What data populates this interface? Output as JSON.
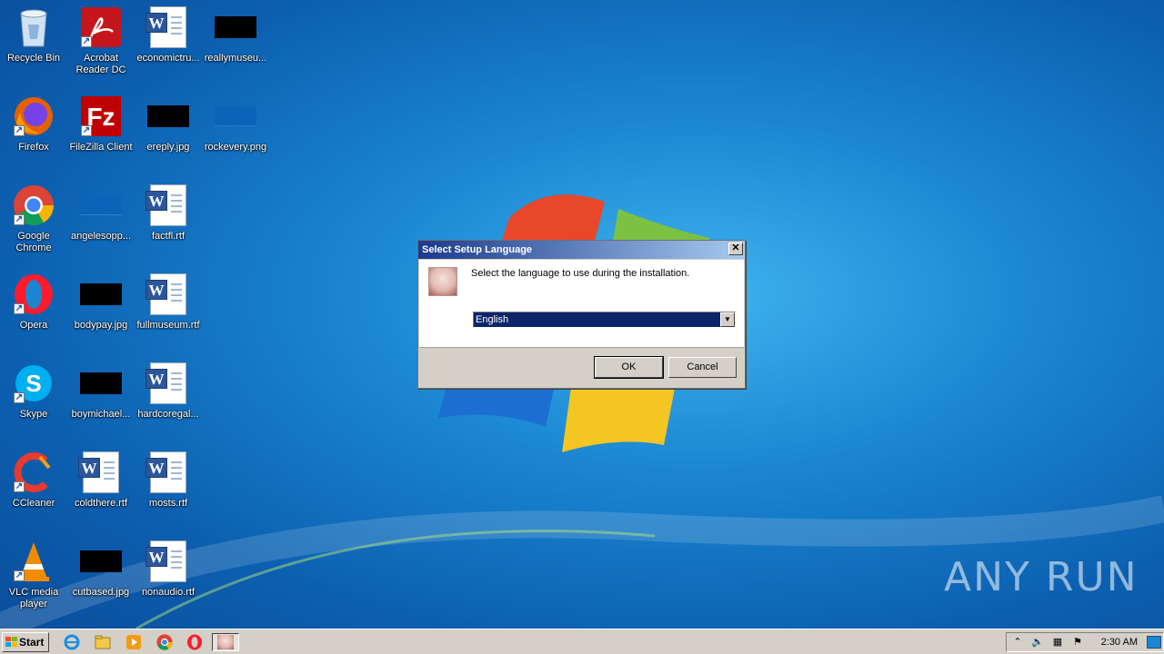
{
  "desktop": {
    "icons": [
      {
        "label": "Recycle Bin",
        "icon": "recycle-bin-icon"
      },
      {
        "label": "Acrobat Reader DC",
        "icon": "acrobat-icon"
      },
      {
        "label": "economictru...",
        "icon": "word-rtf-icon"
      },
      {
        "label": "reallymuseu...",
        "icon": "image-thumbnail-icon"
      },
      {
        "label": "Firefox",
        "icon": "firefox-icon"
      },
      {
        "label": "FileZilla Client",
        "icon": "filezilla-icon"
      },
      {
        "label": "ereply.jpg",
        "icon": "image-thumbnail-icon"
      },
      {
        "label": "rockevery.png",
        "icon": "image-thumbnail-icon"
      },
      {
        "label": "Google Chrome",
        "icon": "chrome-icon"
      },
      {
        "label": "angelesopp...",
        "icon": "image-thumbnail-icon"
      },
      {
        "label": "factfl.rtf",
        "icon": "word-rtf-icon"
      },
      {
        "label": "Opera",
        "icon": "opera-icon"
      },
      {
        "label": "bodypay.jpg",
        "icon": "image-thumbnail-icon"
      },
      {
        "label": "fullmuseum.rtf",
        "icon": "word-rtf-icon"
      },
      {
        "label": "Skype",
        "icon": "skype-icon"
      },
      {
        "label": "boymichael...",
        "icon": "image-thumbnail-icon"
      },
      {
        "label": "hardcoregal...",
        "icon": "word-rtf-icon"
      },
      {
        "label": "CCleaner",
        "icon": "ccleaner-icon"
      },
      {
        "label": "coldthere.rtf",
        "icon": "word-rtf-icon"
      },
      {
        "label": "mosts.rtf",
        "icon": "word-rtf-icon"
      },
      {
        "label": "VLC media player",
        "icon": "vlc-icon"
      },
      {
        "label": "cutbased.jpg",
        "icon": "image-thumbnail-icon"
      },
      {
        "label": "nonaudio.rtf",
        "icon": "word-rtf-icon"
      }
    ]
  },
  "dialog": {
    "title": "Select Setup Language",
    "message": "Select the language to use during the installation.",
    "language_selected": "English",
    "ok_label": "OK",
    "cancel_label": "Cancel",
    "close_glyph": "✕"
  },
  "taskbar": {
    "start_label": "Start",
    "clock": "2:30 AM",
    "pinned": [
      "internet-explorer-icon",
      "file-explorer-icon",
      "media-player-icon",
      "chrome-icon",
      "opera-icon",
      "setup-app-icon"
    ]
  },
  "watermark": "ANY RUN",
  "colors": {
    "accent_dialog_title": "#1c3a8c",
    "selection": "#0a246a",
    "desktop_bg": "#1a86d2"
  }
}
